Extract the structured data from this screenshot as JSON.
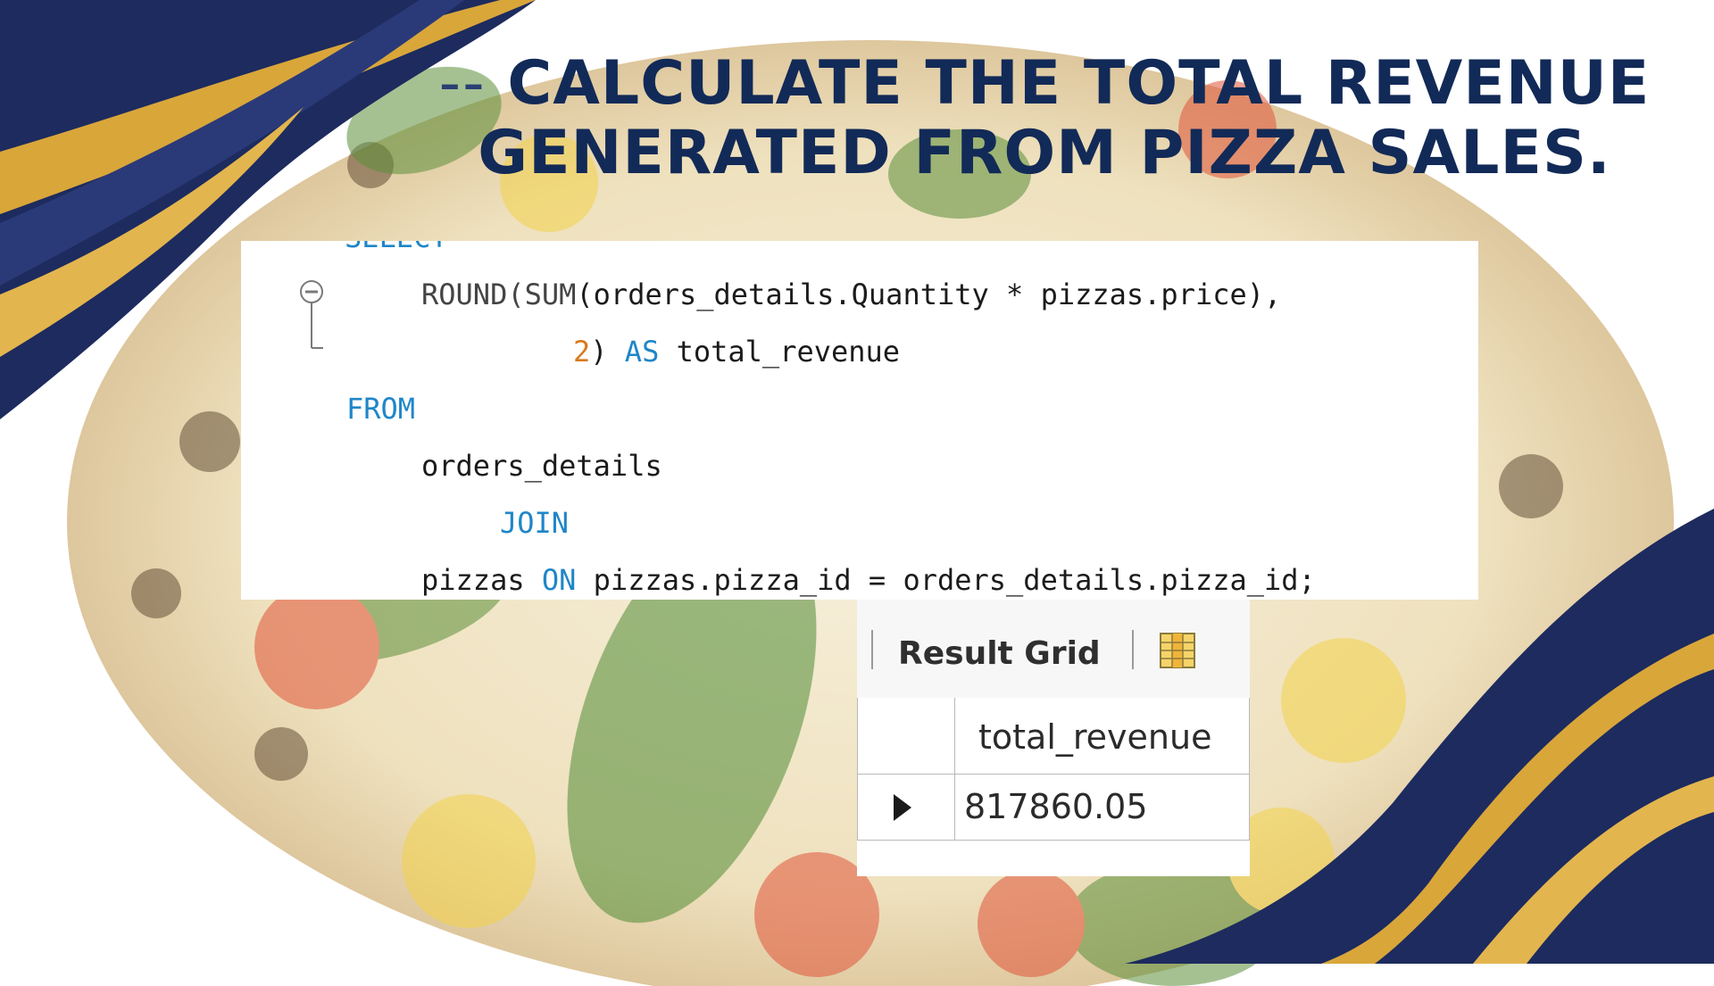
{
  "slide": {
    "title_prefix": "-- ",
    "title_line1": "CALCULATE THE TOTAL REVENUE",
    "title_line2": "GENERATED FROM PIZZA SALES."
  },
  "sql": {
    "lines": [
      "SELECT",
      "ROUND(SUM(orders_details.Quantity * pizzas.price),",
      "2) AS total_revenue",
      "FROM",
      "orders_details",
      "JOIN",
      "pizzas ON pizzas.pizza_id = orders_details.pizza_id;"
    ],
    "line2_parts": {
      "fn": "ROUND(SUM",
      "rest": "(orders_details.Quantity * pizzas.price),"
    },
    "line3_parts": {
      "num": "2",
      "close": ") ",
      "kw": "AS",
      "rest": " total_revenue"
    },
    "line7_parts": {
      "pre": "pizzas ",
      "kw": "ON",
      "rest": " pizzas.pizza_id = orders_details.pizza_id;"
    }
  },
  "result_grid": {
    "tab_label": "Result Grid",
    "column_header": "total_revenue",
    "value": "817860.05"
  },
  "colors": {
    "title": "#122a57",
    "navy": "#1d2b5e",
    "gold": "#d9a63a",
    "keyword": "#1f86c8",
    "number": "#d67a1d"
  },
  "icons": [
    "fold-collapse-icon",
    "grid-view-icon",
    "row-pointer-icon"
  ]
}
